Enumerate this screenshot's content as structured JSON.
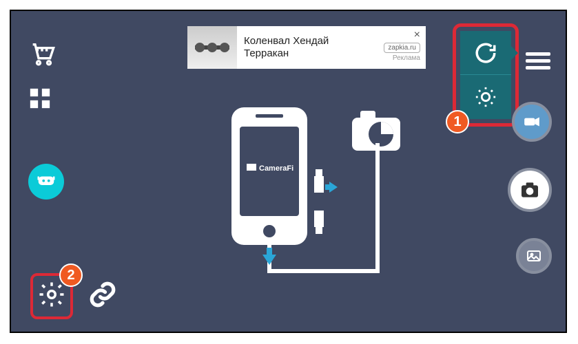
{
  "sidebar": {
    "cart": "cart",
    "apps": "apps",
    "chat": "chat"
  },
  "bottom": {
    "gear": "settings",
    "link": "link",
    "badge": "2"
  },
  "ad": {
    "title_line1": "Коленвал Хендай",
    "title_line2": "Терракан",
    "domain": "zapkia.ru",
    "label": "Реклама",
    "close": "×"
  },
  "center": {
    "brand": "CameraFi"
  },
  "top_right": {
    "rotate": "rotate",
    "brightness": "brightness",
    "badge": "1"
  },
  "right_buttons": {
    "video": "video",
    "camera": "camera",
    "gallery": "gallery"
  }
}
